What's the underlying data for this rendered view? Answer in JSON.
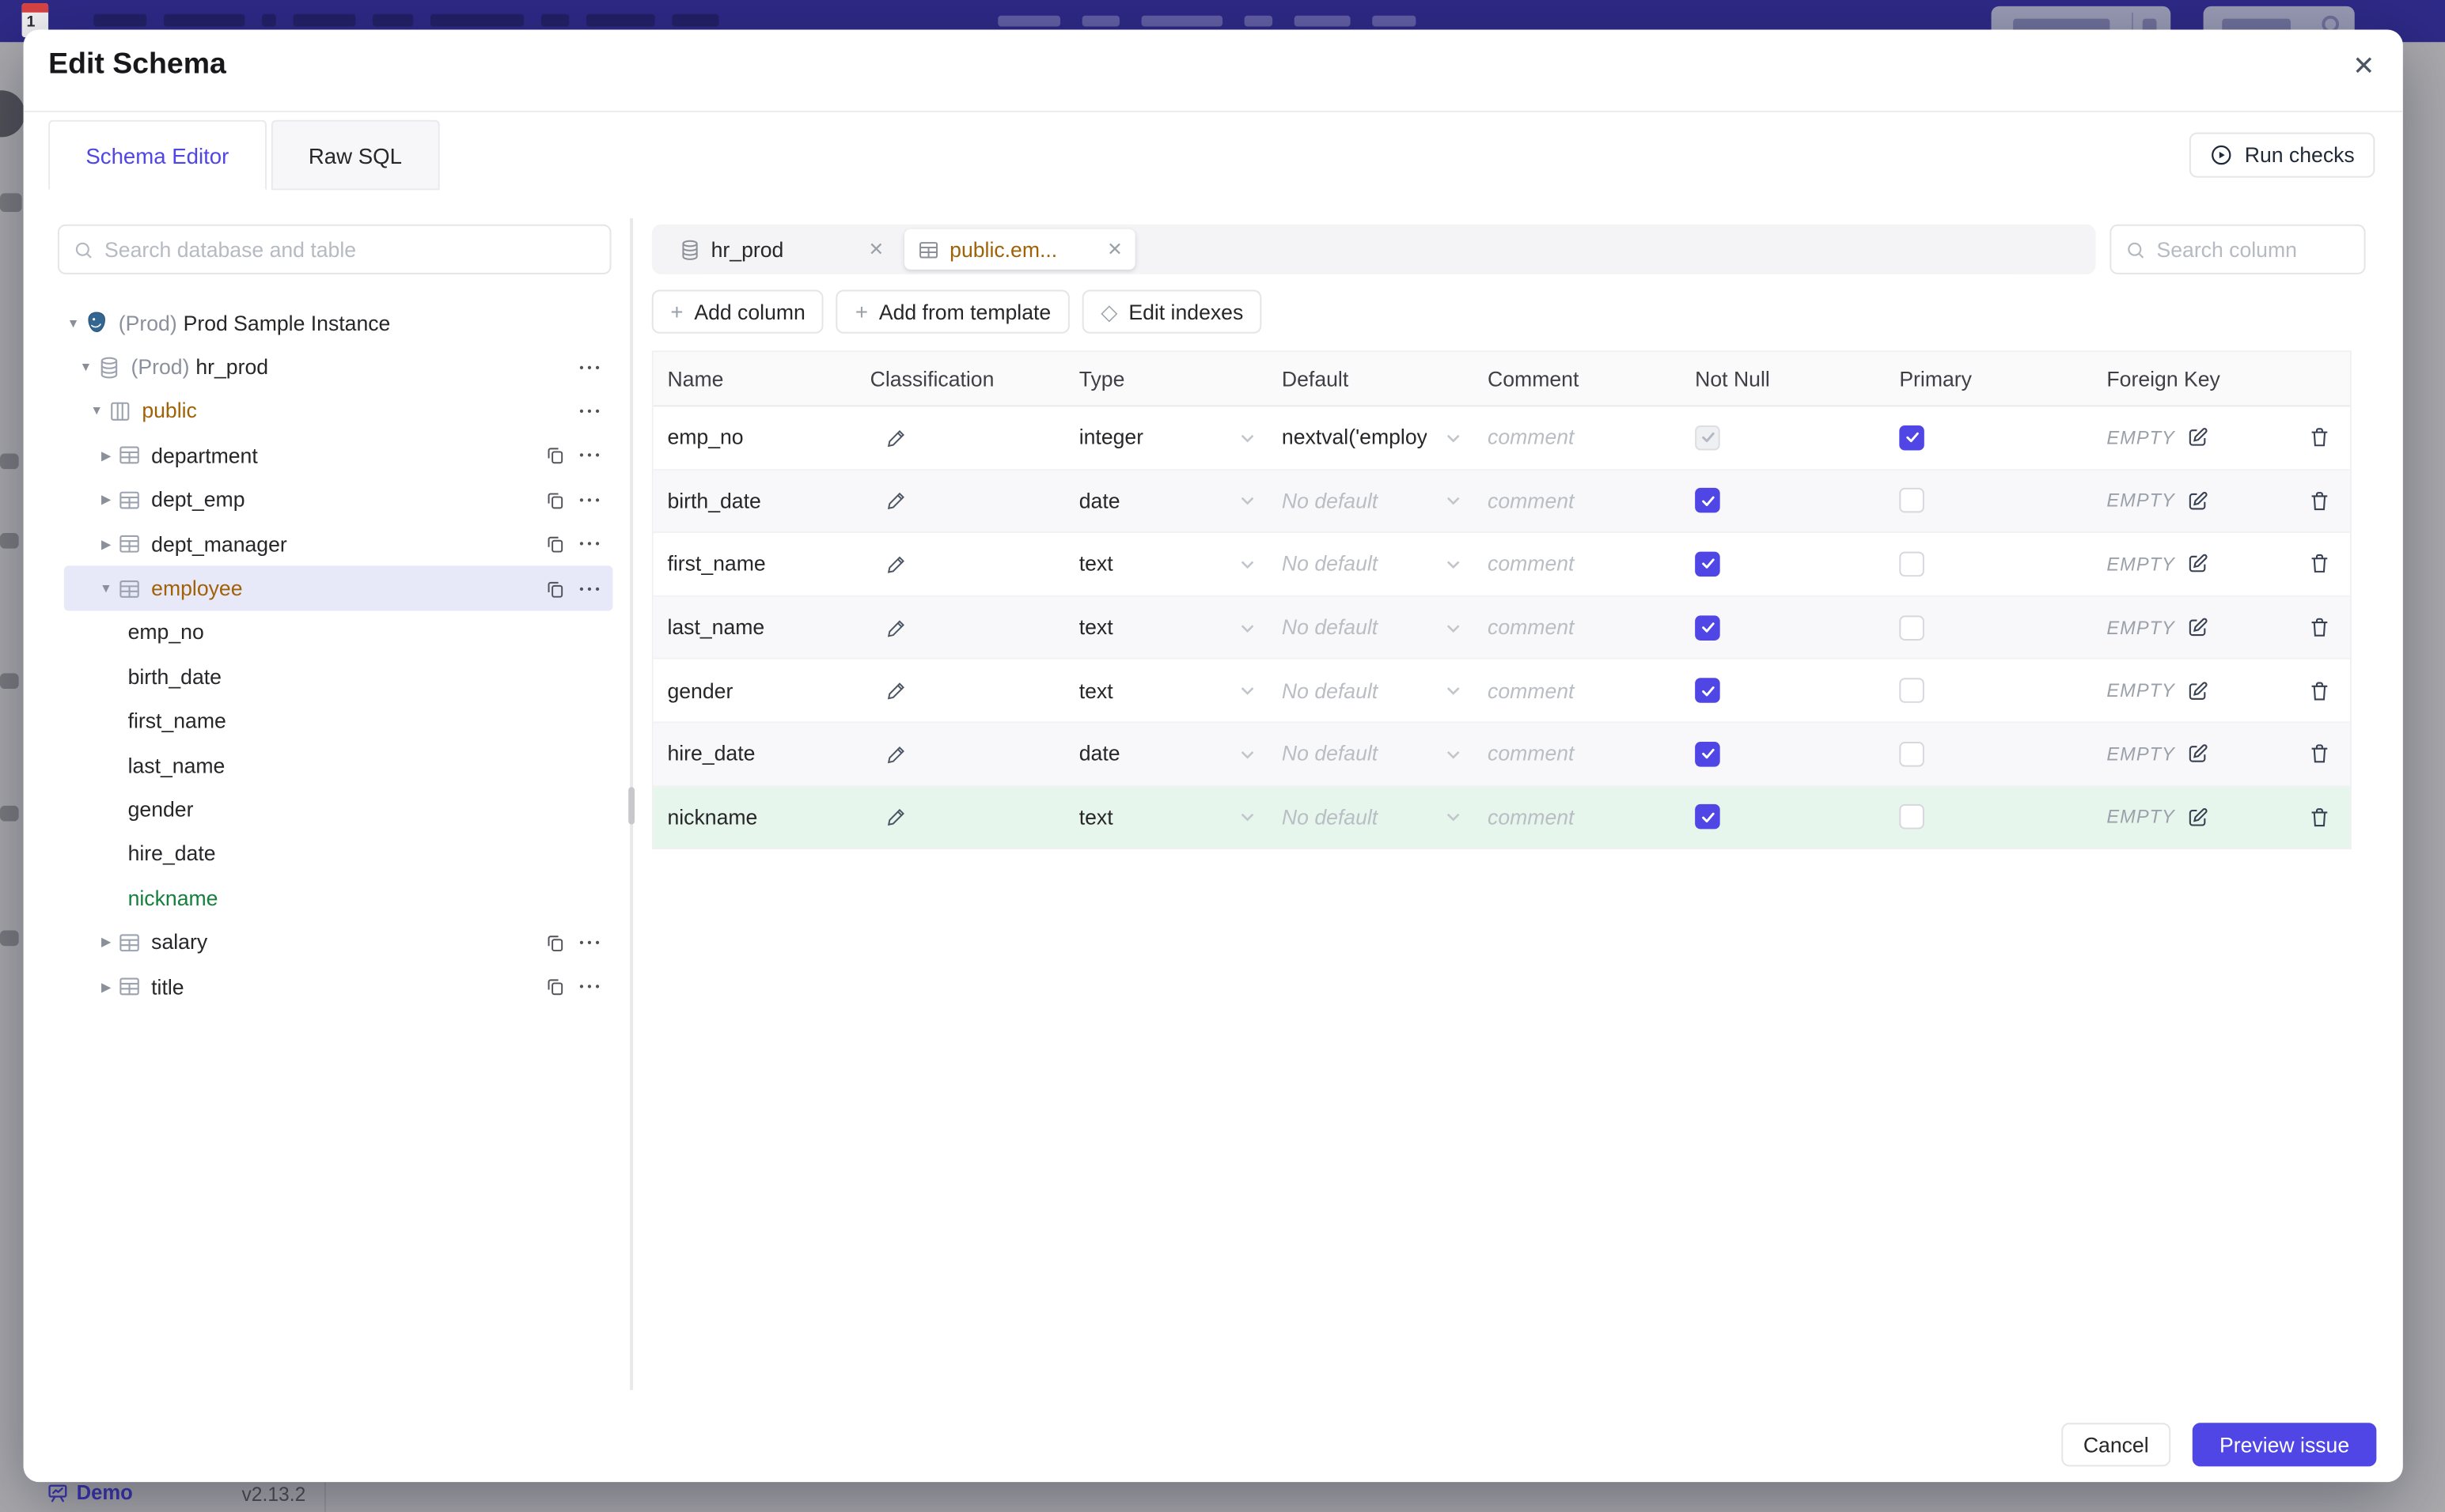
{
  "colors": {
    "accent": "#4f46e5",
    "amber_changed": "#a16207",
    "green_added": "#15803d",
    "green_row_bg": "#e7f6ed",
    "selected_row_bg": "#e7e8f8",
    "topbar": "#2e2a87"
  },
  "backdrop": {
    "favicon_label": "1",
    "statusbar": {
      "demo_label": "Demo",
      "version": "v2.13.2"
    }
  },
  "modal": {
    "title": "Edit Schema",
    "close_glyph": "✕",
    "tabs": [
      {
        "label": "Schema Editor",
        "active": true
      },
      {
        "label": "Raw SQL",
        "active": false
      }
    ],
    "run_checks_label": "Run checks"
  },
  "sidebar": {
    "search_placeholder": "Search database and table",
    "tree": [
      {
        "level": 0,
        "icon": "postgres",
        "arrow": "down",
        "prefix": "(Prod)",
        "label": "Prod Sample Instance",
        "actions": []
      },
      {
        "level": 1,
        "icon": "database",
        "arrow": "down",
        "prefix": "(Prod)",
        "label": "hr_prod",
        "actions": [
          "more"
        ]
      },
      {
        "level": 2,
        "icon": "schema",
        "arrow": "down",
        "label": "public",
        "color": "amber",
        "actions": [
          "more"
        ]
      },
      {
        "level": 3,
        "icon": "table",
        "arrow": "right",
        "label": "department",
        "actions": [
          "copy",
          "more"
        ]
      },
      {
        "level": 3,
        "icon": "table",
        "arrow": "right",
        "label": "dept_emp",
        "actions": [
          "copy",
          "more"
        ]
      },
      {
        "level": 3,
        "icon": "table",
        "arrow": "right",
        "label": "dept_manager",
        "actions": [
          "copy",
          "more"
        ]
      },
      {
        "level": 3,
        "icon": "table",
        "arrow": "down",
        "label": "employee",
        "color": "amber",
        "selected": true,
        "actions": [
          "copy",
          "more"
        ]
      },
      {
        "level": 4,
        "label": "emp_no"
      },
      {
        "level": 4,
        "label": "birth_date"
      },
      {
        "level": 4,
        "label": "first_name"
      },
      {
        "level": 4,
        "label": "last_name"
      },
      {
        "level": 4,
        "label": "gender"
      },
      {
        "level": 4,
        "label": "hire_date"
      },
      {
        "level": 4,
        "label": "nickname",
        "color": "green"
      },
      {
        "level": 3,
        "icon": "table",
        "arrow": "right",
        "label": "salary",
        "actions": [
          "copy",
          "more"
        ]
      },
      {
        "level": 3,
        "icon": "table",
        "arrow": "right",
        "label": "title",
        "actions": [
          "copy",
          "more"
        ]
      }
    ]
  },
  "editor": {
    "tabs": [
      {
        "icon": "database",
        "label": "hr_prod",
        "active": false
      },
      {
        "icon": "table",
        "label": "public.em...",
        "active": true,
        "color": "amber"
      }
    ],
    "close_glyph": "✕",
    "search_placeholder": "Search column",
    "toolbar": [
      {
        "glyph": "+",
        "label": "Add column"
      },
      {
        "glyph": "+",
        "label": "Add from template"
      },
      {
        "glyph": "◇",
        "label": "Edit indexes"
      }
    ],
    "table": {
      "headers": [
        "Name",
        "Classification",
        "Type",
        "Default",
        "Comment",
        "Not Null",
        "Primary",
        "Foreign Key",
        ""
      ],
      "comment_placeholder": "comment",
      "foreign_key_empty": "EMPTY",
      "rows": [
        {
          "name": "emp_no",
          "type": "integer",
          "default": "nextval('employ",
          "default_is_placeholder": false,
          "not_null": "checked-disabled",
          "primary": "checked",
          "highlight": null
        },
        {
          "name": "birth_date",
          "type": "date",
          "default": "No default",
          "default_is_placeholder": true,
          "not_null": "checked",
          "primary": "unchecked",
          "highlight": null
        },
        {
          "name": "first_name",
          "type": "text",
          "default": "No default",
          "default_is_placeholder": true,
          "not_null": "checked",
          "primary": "unchecked",
          "highlight": null
        },
        {
          "name": "last_name",
          "type": "text",
          "default": "No default",
          "default_is_placeholder": true,
          "not_null": "checked",
          "primary": "unchecked",
          "highlight": null
        },
        {
          "name": "gender",
          "type": "text",
          "default": "No default",
          "default_is_placeholder": true,
          "not_null": "checked",
          "primary": "unchecked",
          "highlight": null
        },
        {
          "name": "hire_date",
          "type": "date",
          "default": "No default",
          "default_is_placeholder": true,
          "not_null": "checked",
          "primary": "unchecked",
          "highlight": null
        },
        {
          "name": "nickname",
          "type": "text",
          "default": "No default",
          "default_is_placeholder": true,
          "not_null": "checked",
          "primary": "unchecked",
          "highlight": "green"
        }
      ]
    }
  },
  "footer": {
    "cancel_label": "Cancel",
    "primary_label": "Preview issue"
  }
}
